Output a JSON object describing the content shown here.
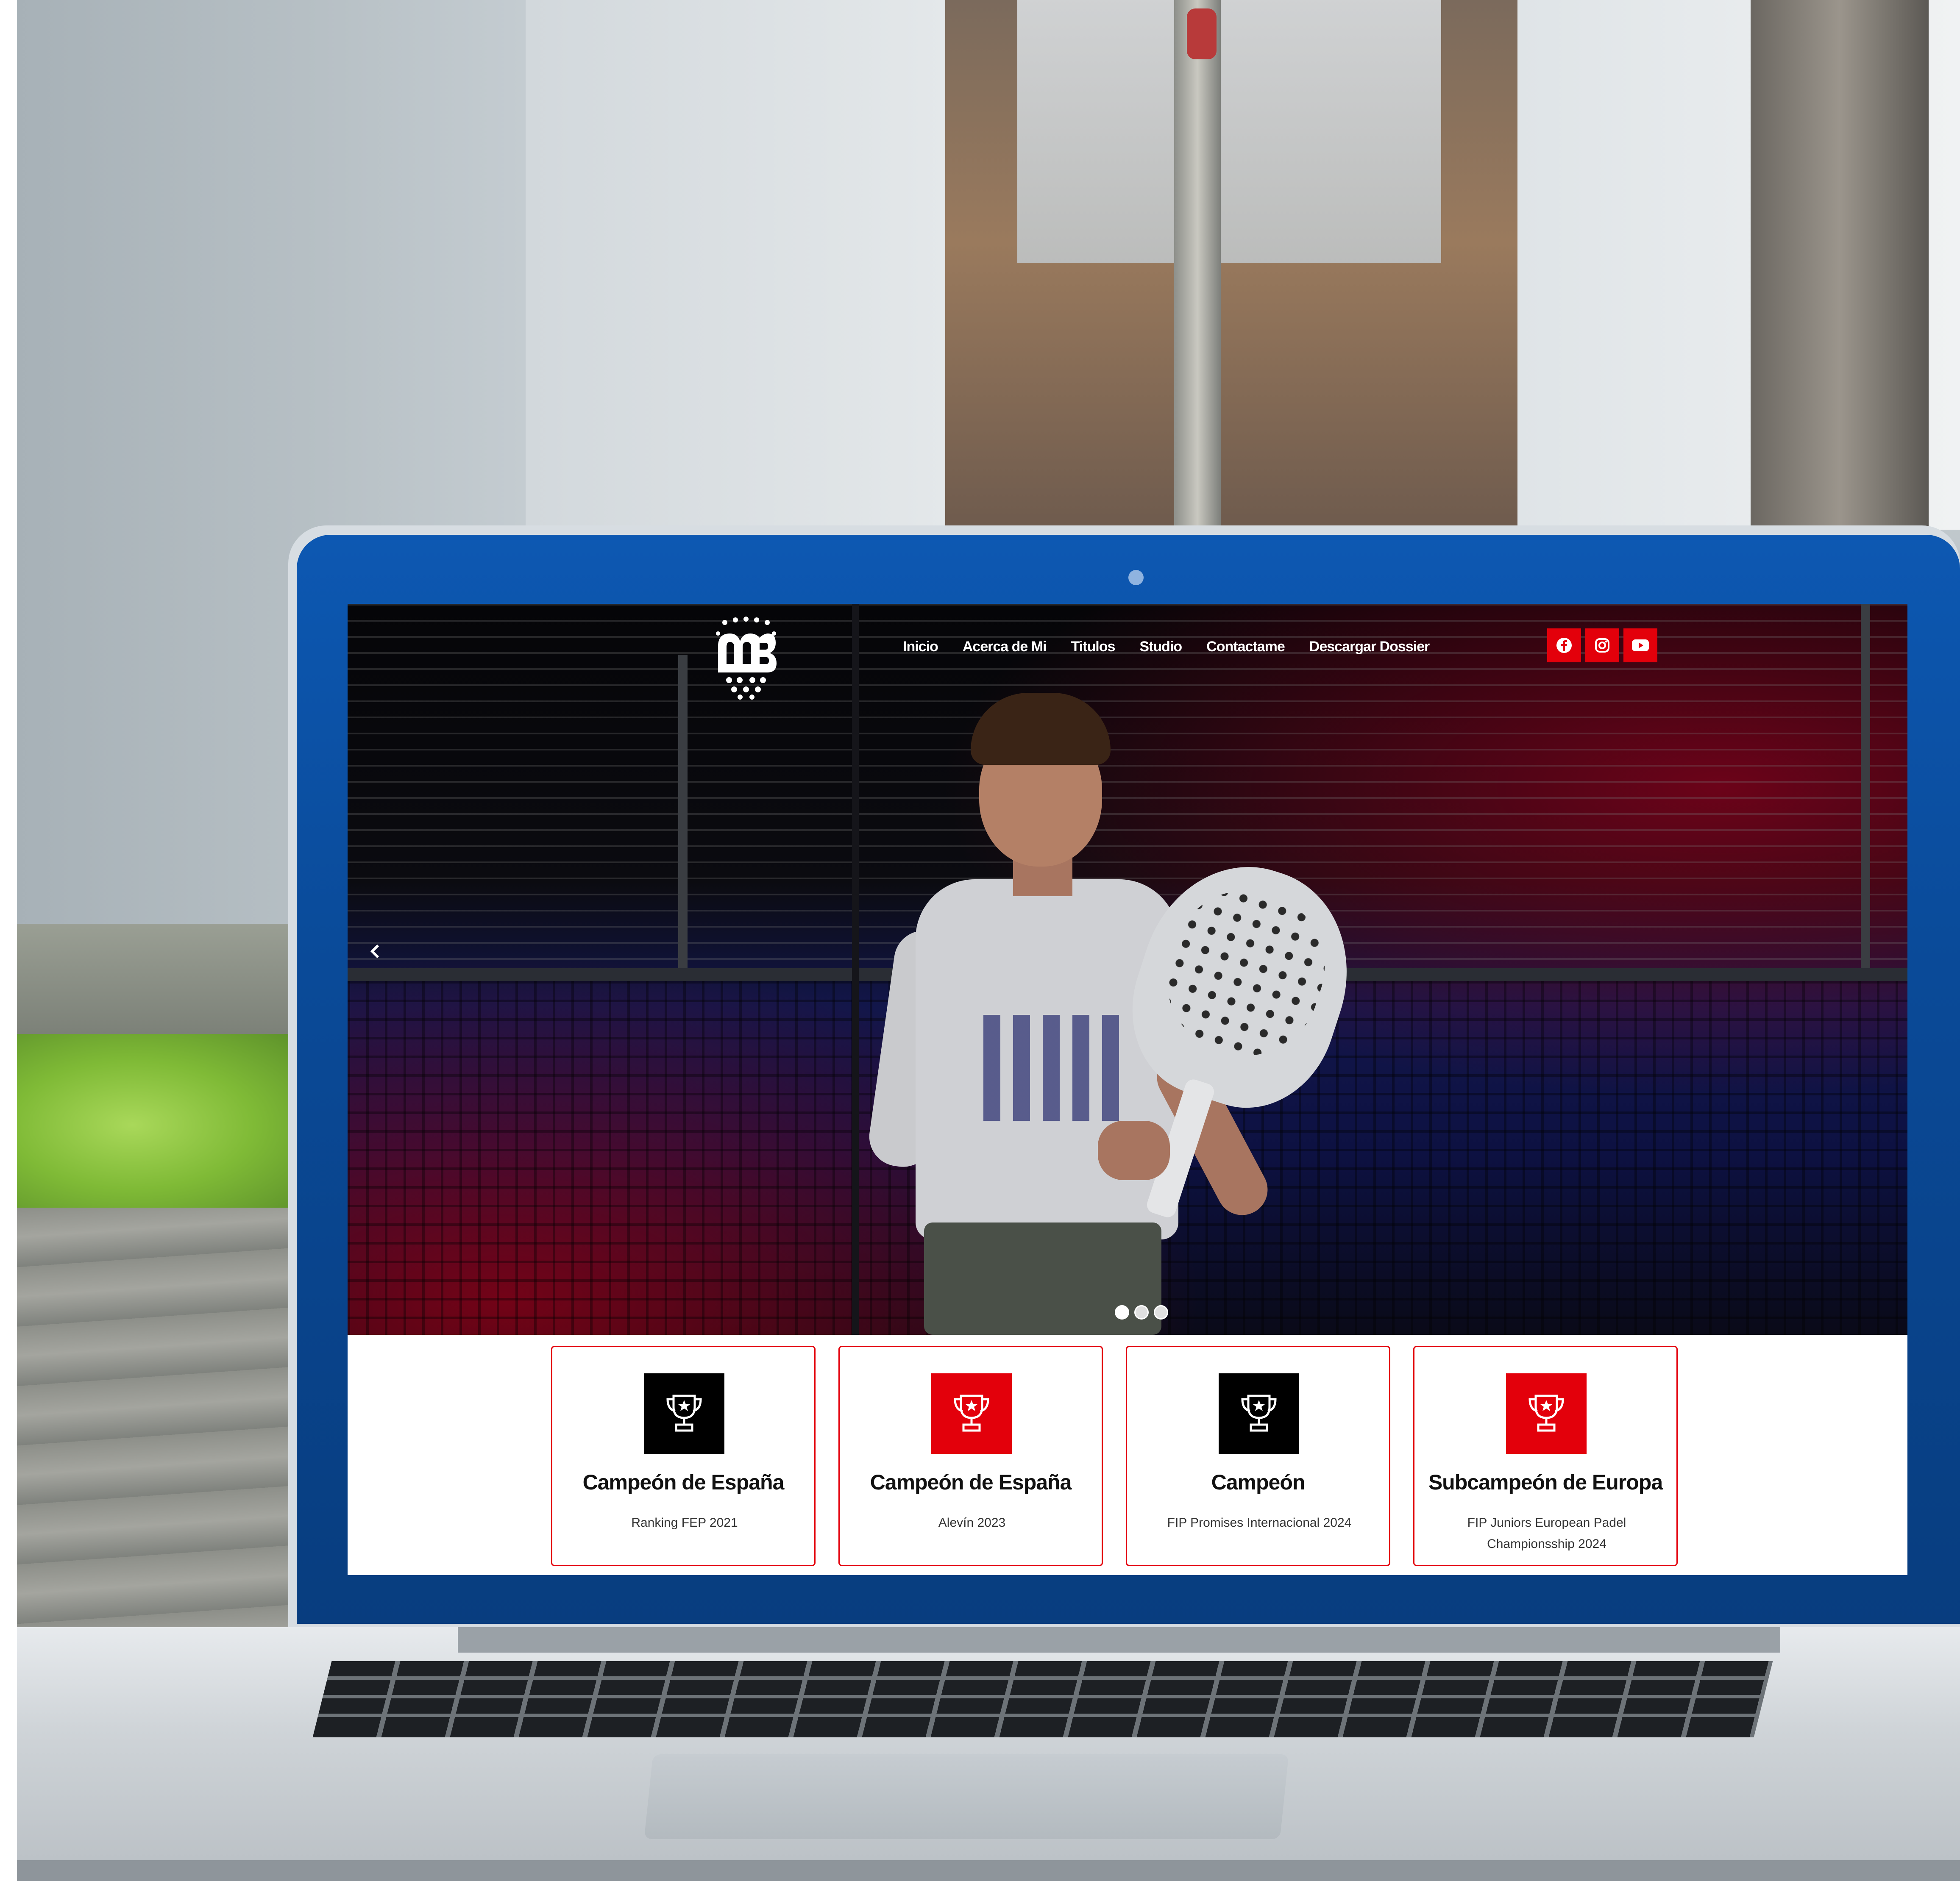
{
  "site": {
    "logo_text": "MB",
    "nav": [
      "Inicio",
      "Acerca de Mi",
      "Titulos",
      "Studio",
      "Contactame",
      "Descargar Dossier"
    ],
    "social": [
      {
        "icon": "facebook-icon"
      },
      {
        "icon": "instagram-icon"
      },
      {
        "icon": "youtube-icon"
      }
    ],
    "slider": {
      "count": 3,
      "active_index": 0
    },
    "cards": [
      {
        "title": "Campeón de España",
        "subtitle": "Ranking FEP 2021",
        "icon_bg": "#000000"
      },
      {
        "title": "Campeón de España",
        "subtitle": "Alevín 2023",
        "icon_bg": "#e3000b"
      },
      {
        "title": "Campeón",
        "subtitle": "FIP Promises Internacional 2024",
        "icon_bg": "#000000"
      },
      {
        "title": "Subcampeón de Europa",
        "subtitle": "FIP Juniors European Padel Championsship 2024",
        "icon_bg": "#e3000b"
      }
    ]
  },
  "colors": {
    "accent": "#e3000b",
    "laptop_bezel": "#0a4a98"
  }
}
